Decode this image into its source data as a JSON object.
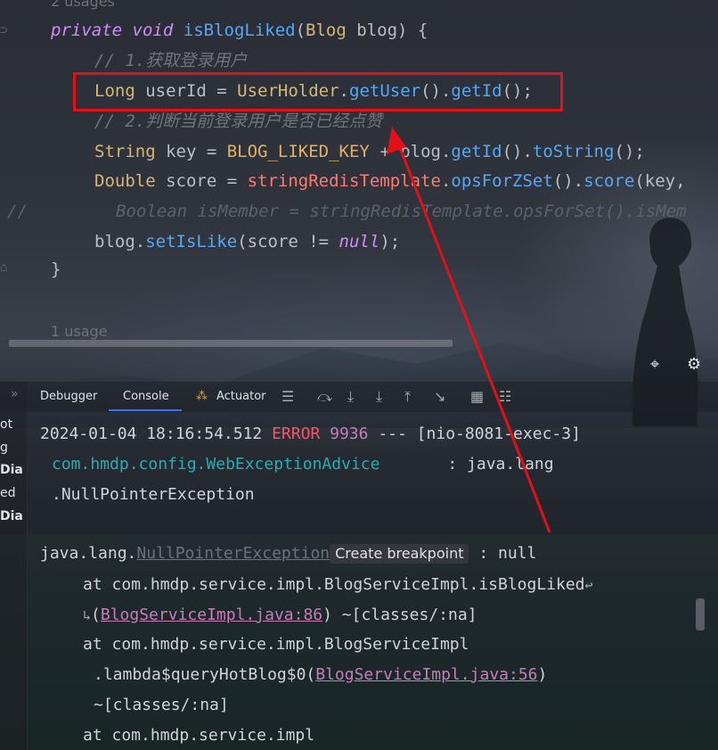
{
  "editor": {
    "usage_top": "2 usages",
    "line1": {
      "kw1": "private",
      "kw2": "void",
      "method": "isBlogLiked",
      "open": "(",
      "type": "Blog",
      "param": " blog) {"
    },
    "comment1": "// 1.获取登录用户",
    "line3": {
      "type": "Long",
      "rest1": " userId = ",
      "cls": "UserHolder",
      "dot1": ".",
      "m1": "getUser",
      "p1": "().",
      "m2": "getId",
      "p2": "();"
    },
    "comment2": "// 2.判断当前登录用户是否已经点赞",
    "line5": {
      "type": "String",
      "rest1": " key = ",
      "const": "BLOG_LIKED_KEY",
      "rest2": " + blog.",
      "m1": "getId",
      "p1": "().",
      "m2": "toString",
      "p2": "();"
    },
    "line6": {
      "type": "Double",
      "rest1": " score = ",
      "field": "stringRedisTemplate",
      "dot": ".",
      "m1": "opsForZSet",
      "p1": "().",
      "m2": "score",
      "p2": "(key,"
    },
    "gutter_comment": "//",
    "line7": "Boolean isMember = stringRedisTemplate.opsForSet().isMem",
    "line8": {
      "obj": "blog.",
      "m": "setIsLike",
      "p1": "(score != ",
      "kw": "null",
      "p2": ");"
    },
    "close_brace": "}",
    "usage_bottom": "1 usage"
  },
  "toolbar": {
    "chevron": "»",
    "tabs": [
      "Debugger",
      "Console",
      "Actuator"
    ],
    "active_tab": "Console",
    "icons": [
      "menu-icon",
      "step-over-icon",
      "step-into-icon",
      "force-step-into-icon",
      "step-out-icon",
      "run-to-cursor-icon",
      "frames-icon",
      "threads-icon"
    ]
  },
  "left_strip": [
    "ot",
    "g",
    "Dia",
    "ed",
    "Dia"
  ],
  "console": {
    "log": {
      "timestamp": "2024-01-04 18:16:54.512",
      "level": "ERROR",
      "pid": "9936",
      "sep": "---",
      "thread": "[nio-8081-exec-3]",
      "logger": "com.hmdp.config.WebExceptionAdvice",
      "colon": ":",
      "msg1": "java.lang",
      "msg2": ".NullPointerException"
    },
    "exception": {
      "prefix": "java.lang.",
      "name": "NullPointerException",
      "tooltip": "Create breakpoint",
      "suffix": ": null"
    },
    "stack": [
      {
        "text": "at com.hmdp.service.impl.BlogServiceImpl.isBlogLiked"
      },
      {
        "pre": "(",
        "link": "BlogServiceImpl.java:86",
        "post": ") ~[classes/:na]"
      },
      {
        "text": "at com.hmdp.service.impl.BlogServiceImpl"
      },
      {
        "pre": ".lambda$queryHotBlog$0(",
        "link": "BlogServiceImpl.java:56",
        "post": ")"
      },
      {
        "text": "~[classes/:na]"
      },
      {
        "text": "at com.hmdp.service.impl"
      }
    ]
  },
  "annotation": {
    "box_color": "#e3101a",
    "arrow_color": "#e3101a"
  }
}
